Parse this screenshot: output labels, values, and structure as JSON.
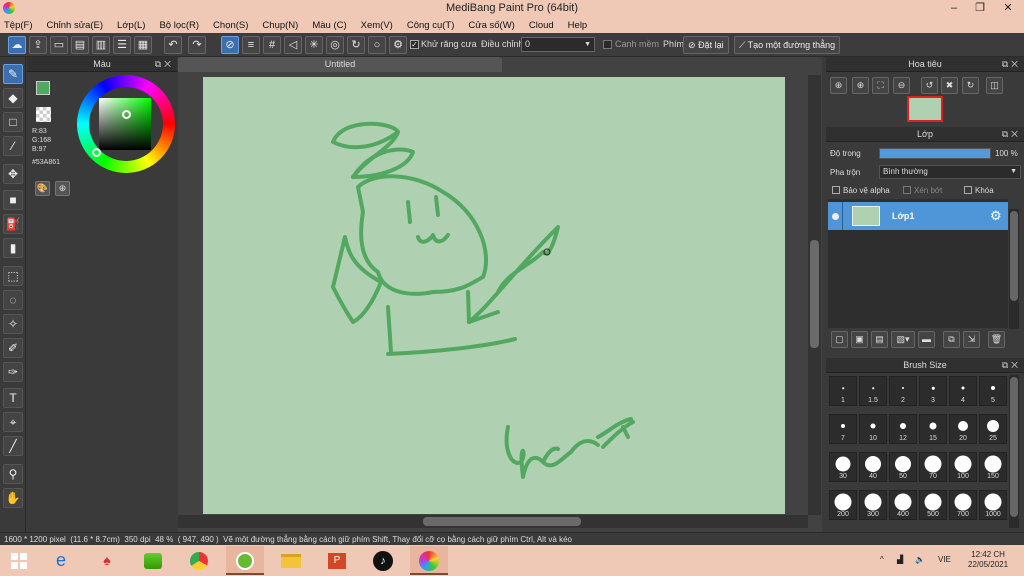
{
  "window": {
    "title": "MediBang Paint Pro (64bit)"
  },
  "menu": [
    "Tệp(F)",
    "Chỉnh sửa(E)",
    "Lớp(L)",
    "Bộ lọc(R)",
    "Chọn(S)",
    "Chụp(N)",
    "Màu (C)",
    "Xem(V)",
    "Công cụ(T)",
    "Cửa số(W)",
    "Cloud",
    "Help"
  ],
  "toolbar": {
    "antialias_label": "Khử răng cưa",
    "adjust_label": "Điều chỉnh",
    "adjust_value": "0",
    "edge_label": "Canh mềm",
    "key_label": "Phím",
    "reset_label": "Đặt lại",
    "straight_line_label": "Tạo một đường thẳng"
  },
  "color_panel": {
    "title": "Màu",
    "r": "R:83",
    "g": "G:168",
    "b": "B:97",
    "hex": "#53A861",
    "main_color": "#53A861"
  },
  "document": {
    "tab_title": "Untitled",
    "canvas_color": "#B0D1B1",
    "stroke_color": "#53A861"
  },
  "navigator": {
    "title": "Hoa tiêu"
  },
  "layer_panel": {
    "title": "Lớp",
    "opacity_label": "Độ trong",
    "opacity_value": "100 %",
    "opacity": 1.0,
    "blend_label": "Pha trộn",
    "blend_value": "Bình thường",
    "protect_alpha": "Bảo vệ alpha",
    "clipping": "Xén bớt",
    "lock": "Khóa",
    "layers": [
      {
        "name": "Lớp1",
        "selected": true
      }
    ]
  },
  "brush_panel": {
    "title": "Brush Size",
    "sizes": [
      "1",
      "1.5",
      "2",
      "3",
      "4",
      "5",
      "7",
      "10",
      "12",
      "15",
      "20",
      "25",
      "30",
      "40",
      "50",
      "70",
      "100",
      "150",
      "200",
      "300",
      "400",
      "500",
      "700",
      "1000"
    ]
  },
  "status": {
    "size": "1600 * 1200 pixel",
    "physical": "(11.6 * 8.7cm)",
    "dpi": "350 dpi",
    "zoom": "48 %",
    "cursor": "( 947, 490 )",
    "hint": "Vẽ một đường thẳng bằng cách giữ phím Shift, Thay đổi cỡ cọ bằng cách giữ phím Ctrl, Alt và kéo"
  },
  "taskbar": {
    "lang": "VIE",
    "time": "12:42 CH",
    "date": "22/05/2021"
  }
}
